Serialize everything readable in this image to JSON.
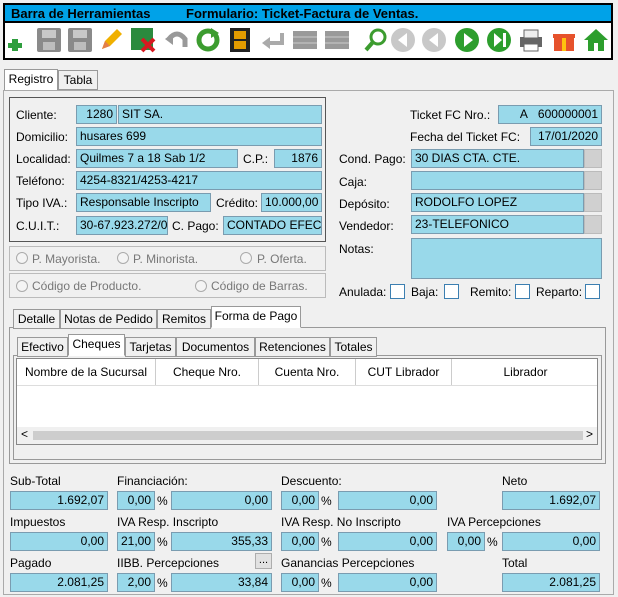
{
  "title": {
    "left": "Barra de Herramientas",
    "right": "Formulario: Ticket-Factura de Ventas."
  },
  "toolbar": {
    "icons": [
      "add-icon",
      "save-icon",
      "save-as-icon",
      "edit-icon",
      "delete-icon",
      "undo-icon",
      "refresh-icon",
      "film-icon",
      "back-arrow-icon",
      "grid-icon",
      "grid2-icon",
      "search-icon",
      "first-icon",
      "prev-icon",
      "next-icon",
      "last-icon",
      "print-icon",
      "gift-icon",
      "home-icon"
    ]
  },
  "tabs": {
    "registro": "Registro",
    "tabla": "Tabla"
  },
  "form": {
    "cliente_label": "Cliente:",
    "cliente_code": "1280",
    "cliente_name": "SIT SA.",
    "domicilio_label": "Domicilio:",
    "domicilio": "husares  699",
    "localidad_label": "Localidad:",
    "localidad": "Quilmes 7 a 18 Sab 1/2",
    "cp_label": "C.P.:",
    "cp": "1876",
    "telefono_label": "Teléfono:",
    "telefono": "4254-8321/4253-4217",
    "tipo_iva_label": "Tipo IVA.:",
    "tipo_iva": "Responsable Inscripto",
    "credito_label": "Crédito:",
    "credito": "10.000,00",
    "cuit_label": "C.U.I.T.:",
    "cuit": "30-67.923.272/0",
    "cpago_label": "C. Pago:",
    "cpago": "CONTADO EFECTIVO",
    "ticket_label": "Ticket FC Nro.:",
    "ticket_letter": "A",
    "ticket_nro": "600000001",
    "fecha_label": "Fecha del Ticket FC:",
    "fecha": "17/01/2020",
    "cond_label": "Cond. Pago:",
    "cond": "30 DIAS CTA. CTE.",
    "caja_label": "Caja:",
    "caja": "",
    "deposito_label": "Depósito:",
    "deposito": "RODOLFO LOPEZ",
    "vendedor_label": "Vendedor:",
    "vendedor": "23-TELEFONICO",
    "notas_label": "Notas:",
    "radios1": [
      "P. Mayorista.",
      "P. Minorista.",
      "P. Oferta."
    ],
    "radios2": [
      "Código de Producto.",
      "Código de Barras."
    ],
    "anulada": "Anulada:",
    "baja": "Baja:",
    "remito": "Remito:",
    "reparto": "Reparto:"
  },
  "subtabs": [
    "Detalle",
    "Notas de Pedido",
    "Remitos",
    "Forma de Pago"
  ],
  "paytabs": [
    "Efectivo",
    "Cheques",
    "Tarjetas",
    "Documentos",
    "Retenciones",
    "Totales"
  ],
  "table": {
    "columns": [
      "Nombre de la Sucursal",
      "Cheque Nro.",
      "Cuenta Nro.",
      "CUT Librador",
      "Librador"
    ],
    "scroll_left": "<",
    "scroll_right": ">"
  },
  "totals": {
    "subtotal_label": "Sub-Total",
    "subtotal": "1.692,07",
    "financiacion_label": "Financiación:",
    "fin_pct": "0,00",
    "fin_val": "0,00",
    "descuento_label": "Descuento:",
    "desc_pct": "0,00",
    "desc_val": "0,00",
    "neto_label": "Neto",
    "neto": "1.692,07",
    "impuestos_label": "Impuestos",
    "impuestos": "0,00",
    "ivari_label": "IVA Resp. Inscripto",
    "ivari_pct": "21,00",
    "ivari_val": "355,33",
    "ivarni_label": "IVA Resp. No Inscripto",
    "ivarni_pct": "0,00",
    "ivarni_val": "0,00",
    "ivaperc_label": "IVA Percepciones",
    "ivaperc_pct": "0,00",
    "ivaperc_val": "0,00",
    "pagado_label": "Pagado",
    "pagado": "2.081,25",
    "iibb_label": "IIBB. Percepciones",
    "iibb_pct": "2,00",
    "iibb_val": "33,84",
    "iibb_btn": "...",
    "ganancias_label": "Ganancias Percepciones",
    "gan_pct": "0,00",
    "gan_val": "0,00",
    "total_label": "Total",
    "total": "2.081,25",
    "pct": "%"
  }
}
